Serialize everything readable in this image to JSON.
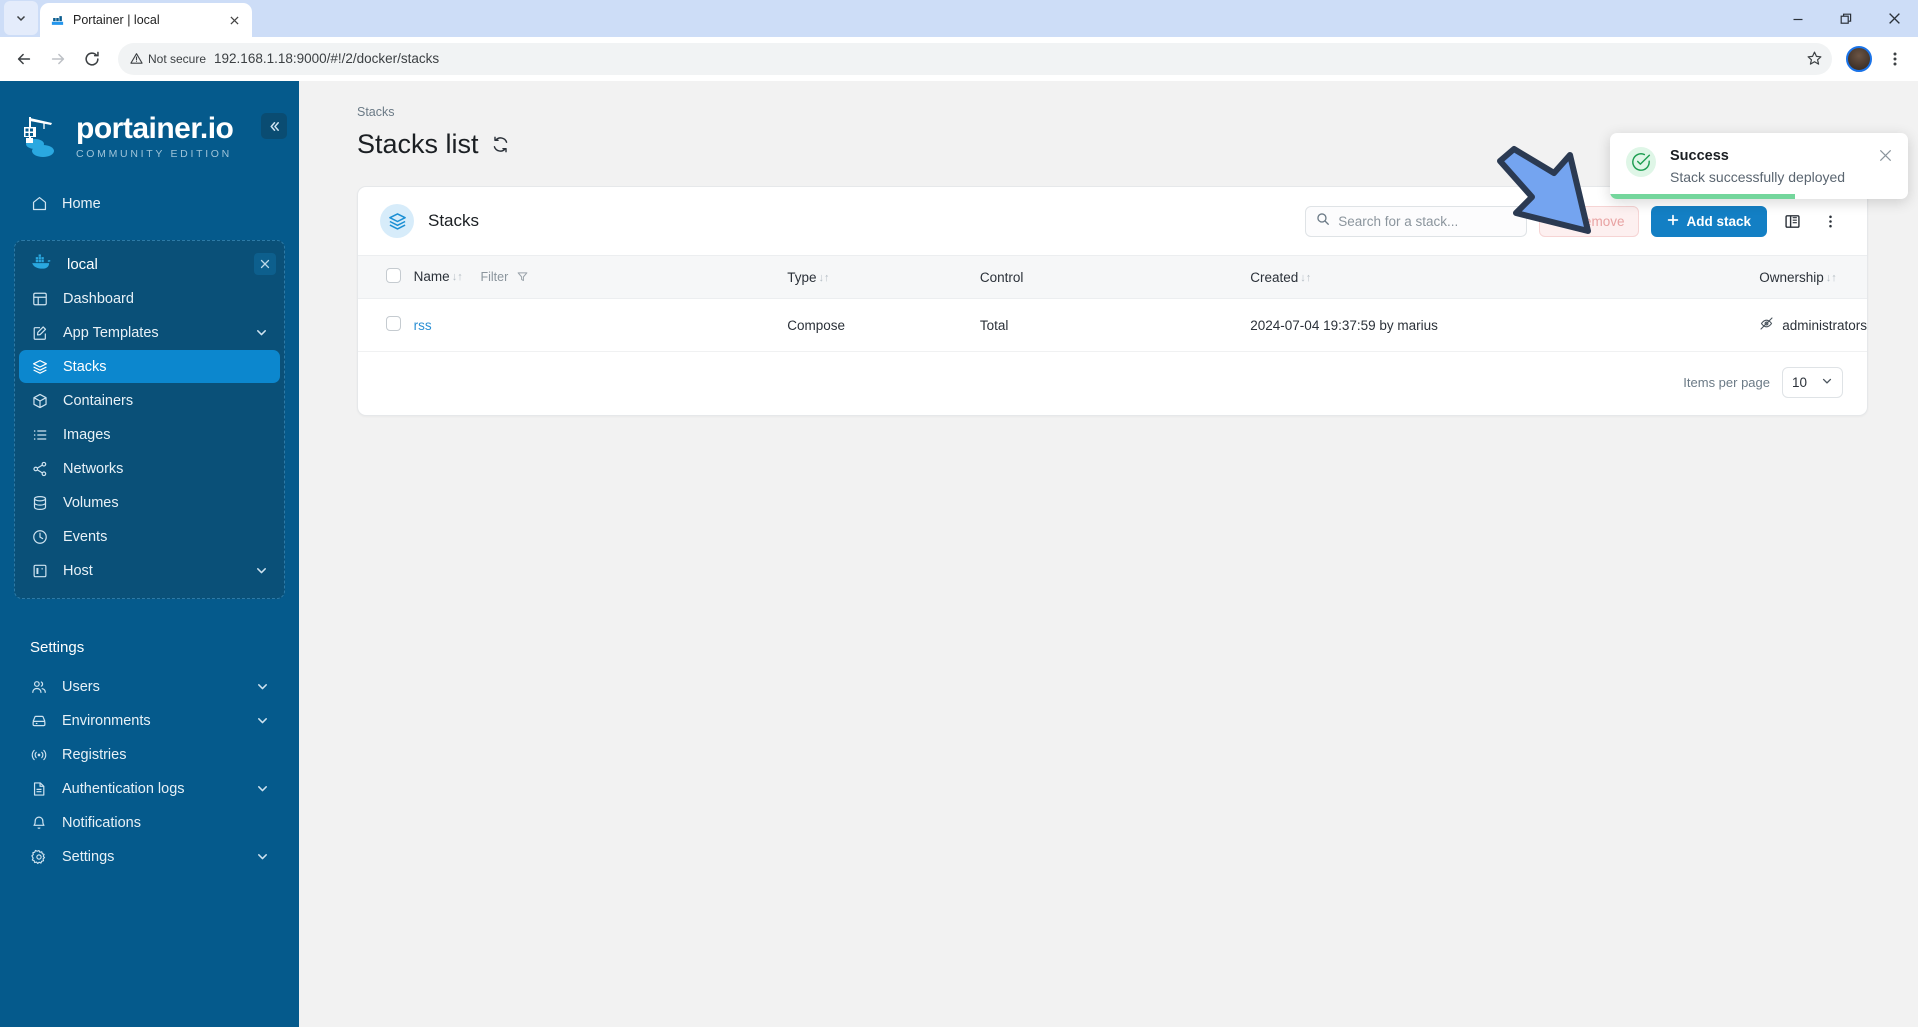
{
  "browser": {
    "tab": {
      "title": "Portainer | local",
      "favicon_icon": "portainer-favicon",
      "close_icon": "close-icon"
    },
    "tabstrip_dropdown_icon": "chevron-down-icon",
    "window_controls": {
      "minimize": "minimize-icon",
      "maximize": "restore-icon",
      "close": "close-icon"
    },
    "back_icon": "arrow-left-icon",
    "forward_icon": "arrow-right-icon",
    "reload_icon": "reload-icon",
    "security_label": "Not secure",
    "security_icon": "warning-triangle-icon",
    "url": "192.168.1.18:9000/#!/2/docker/stacks",
    "bookmark_icon": "star-icon",
    "profile_icon": "avatar",
    "menu_icon": "kebab-menu-icon"
  },
  "sidebar": {
    "collapse_icon": "chevron-double-left-icon",
    "logo": {
      "name": "portainer.io",
      "edition": "COMMUNITY EDITION",
      "icon": "portainer-logo"
    },
    "home": {
      "label": "Home",
      "icon": "home-icon"
    },
    "environment": {
      "name": "local",
      "icon": "docker-whale-icon",
      "close_icon": "close-icon",
      "items": [
        {
          "label": "Dashboard",
          "icon": "dashboard-icon",
          "chevron": false,
          "active": false
        },
        {
          "label": "App Templates",
          "icon": "edit-square-icon",
          "chevron": true,
          "active": false
        },
        {
          "label": "Stacks",
          "icon": "layers-icon",
          "chevron": false,
          "active": true
        },
        {
          "label": "Containers",
          "icon": "box-icon",
          "chevron": false,
          "active": false
        },
        {
          "label": "Images",
          "icon": "list-icon",
          "chevron": false,
          "active": false
        },
        {
          "label": "Networks",
          "icon": "share-nodes-icon",
          "chevron": false,
          "active": false
        },
        {
          "label": "Volumes",
          "icon": "database-icon",
          "chevron": false,
          "active": false
        },
        {
          "label": "Events",
          "icon": "clock-icon",
          "chevron": false,
          "active": false
        },
        {
          "label": "Host",
          "icon": "server-icon",
          "chevron": true,
          "active": false
        }
      ]
    },
    "settings_heading": "Settings",
    "settings_items": [
      {
        "label": "Users",
        "icon": "users-icon",
        "chevron": true
      },
      {
        "label": "Environments",
        "icon": "environment-icon",
        "chevron": true
      },
      {
        "label": "Registries",
        "icon": "radio-waves-icon",
        "chevron": false
      },
      {
        "label": "Authentication logs",
        "icon": "document-icon",
        "chevron": true
      },
      {
        "label": "Notifications",
        "icon": "bell-icon",
        "chevron": false
      },
      {
        "label": "Settings",
        "icon": "gear-icon",
        "chevron": true
      }
    ]
  },
  "main": {
    "breadcrumb": "Stacks",
    "page_title": "Stacks list",
    "refresh_icon": "refresh-icon",
    "card": {
      "badge_icon": "layers-icon",
      "title": "Stacks",
      "search": {
        "placeholder": "Search for a stack...",
        "value": "",
        "icon": "search-icon"
      },
      "remove_button": {
        "label": "Remove",
        "icon": "trash-icon"
      },
      "add_button": {
        "label": "Add stack",
        "icon": "plus-icon"
      },
      "columns_icon": "columns-layout-icon",
      "more_icon": "kebab-menu-icon",
      "table": {
        "select_all_checkbox": "checkbox",
        "columns": [
          {
            "label": "Name",
            "sortable": true,
            "sort_icon": "sort-arrows-icon"
          },
          {
            "label": "Type",
            "sortable": true,
            "sort_icon": "sort-arrows-icon"
          },
          {
            "label": "Control",
            "sortable": false
          },
          {
            "label": "Created",
            "sortable": true,
            "sort_icon": "sort-arrows-icon"
          },
          {
            "label": "Ownership",
            "sortable": true,
            "sort_icon": "sort-arrows-icon"
          }
        ],
        "filter_label": "Filter",
        "filter_icon": "funnel-icon",
        "rows": [
          {
            "name": "rss",
            "type": "Compose",
            "control": "Total",
            "created": "2024-07-04 19:37:59 by marius",
            "ownership": "administrators",
            "ownership_icon": "eye-off-icon"
          }
        ]
      },
      "footer": {
        "items_per_page_label": "Items per page",
        "items_per_page_value": "10",
        "chevron_icon": "chevron-down-icon"
      }
    }
  },
  "toast": {
    "title": "Success",
    "message": "Stack successfully deployed",
    "icon": "check-circle-icon",
    "close_icon": "close-icon",
    "accent_color": "#1f9e52",
    "progress_color": "#74d69c"
  },
  "annotation": {
    "arrow_fill": "#74a4f0",
    "arrow_stroke": "#2b3a52"
  }
}
